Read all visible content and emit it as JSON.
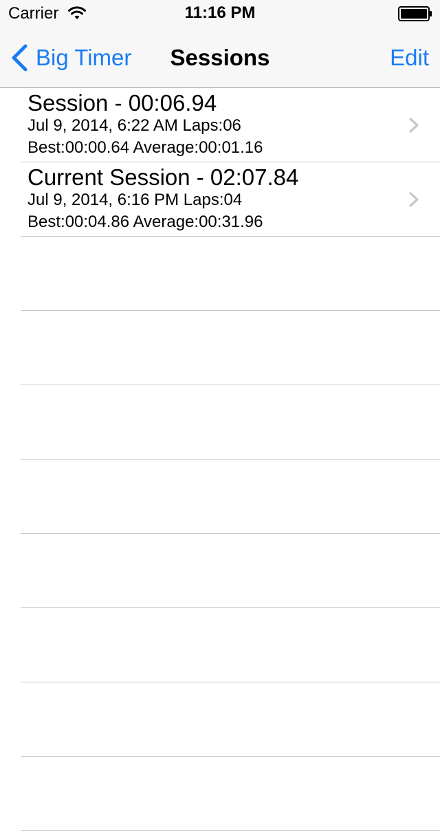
{
  "status_bar": {
    "carrier": "Carrier",
    "time": "11:16 PM"
  },
  "nav": {
    "back_label": "Big Timer",
    "title": "Sessions",
    "edit_label": "Edit"
  },
  "sessions": [
    {
      "title": "Session - 00:06.94",
      "date_laps": "Jul 9, 2014, 6:22 AM Laps:06",
      "stats": "Best:00:00.64 Average:00:01.16"
    },
    {
      "title": "Current Session - 02:07.84",
      "date_laps": "Jul 9, 2014, 6:16 PM Laps:04",
      "stats": "Best:00:04.86 Average:00:31.96"
    }
  ],
  "colors": {
    "accent": "#1a7cf5",
    "separator": "#c8c7cc",
    "disclosure": "#c7c7cc"
  },
  "icons": {
    "wifi": "wifi-icon",
    "battery": "battery-icon",
    "back": "chevron-left-icon",
    "disclosure": "chevron-right-icon"
  }
}
